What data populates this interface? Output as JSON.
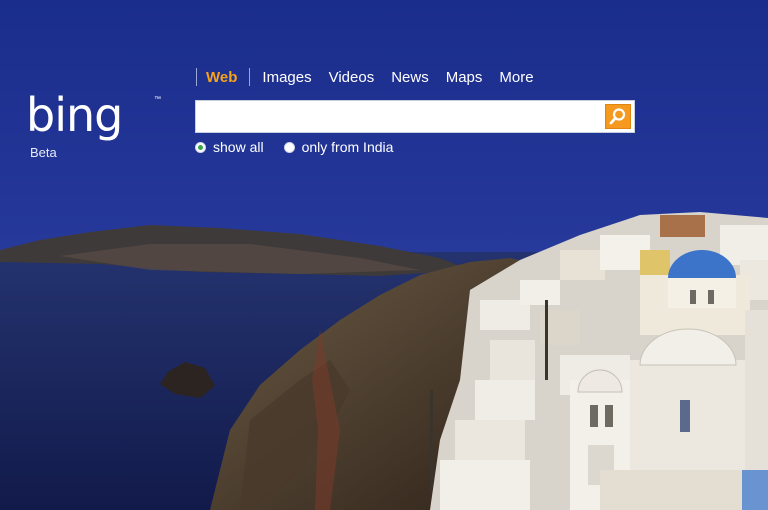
{
  "logo": {
    "text": "bing",
    "tm": "™",
    "beta": "Beta"
  },
  "nav": {
    "items": [
      {
        "label": "Web",
        "active": true
      },
      {
        "label": "Images",
        "active": false
      },
      {
        "label": "Videos",
        "active": false
      },
      {
        "label": "News",
        "active": false
      },
      {
        "label": "Maps",
        "active": false
      },
      {
        "label": "More",
        "active": false
      }
    ]
  },
  "search": {
    "value": "",
    "placeholder": "",
    "button_icon": "magnifier-icon"
  },
  "options": {
    "show_all": {
      "label": "show all",
      "checked": true
    },
    "only_from": {
      "label": "only from India",
      "checked": false
    }
  },
  "colors": {
    "accent": "#f59a1f",
    "sky": "#1d2f8a",
    "sea": "#1b2665"
  }
}
